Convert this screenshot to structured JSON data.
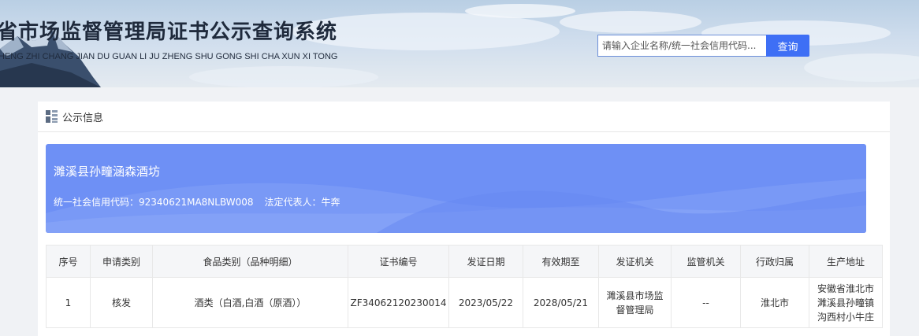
{
  "header": {
    "title": "省市场监督管理局证书公示查询系统",
    "subtitle": "HENG ZHI CHANG JIAN DU GUAN LI JU ZHENG SHU GONG SHI CHA XUN XI TONG",
    "search_placeholder": "请输入企业名称/统一社会信用代码...",
    "search_button": "查询"
  },
  "section": {
    "title": "公示信息",
    "icon": "grid-list-icon"
  },
  "company": {
    "name": "濉溪县孙疃涵森酒坊",
    "credit_code_label": "统一社会信用代码：",
    "credit_code": "92340621MA8NLBW008",
    "legal_rep_label": "法定代表人：",
    "legal_rep": "牛奔"
  },
  "table": {
    "headers": [
      "序号",
      "申请类别",
      "食品类别（品种明细）",
      "证书编号",
      "发证日期",
      "有效期至",
      "发证机关",
      "监管机关",
      "行政归属",
      "生产地址"
    ],
    "rows": [
      [
        "1",
        "核发",
        "酒类（白酒,白酒（原酒））",
        "ZF34062120230014",
        "2023/05/22",
        "2028/05/21",
        "濉溪县市场监督管理局",
        "--",
        "淮北市",
        "安徽省淮北市濉溪县孙疃镇沟西村小牛庄"
      ]
    ]
  },
  "colors": {
    "accent": "#3e6ff5",
    "panel": "#6e90f5"
  }
}
